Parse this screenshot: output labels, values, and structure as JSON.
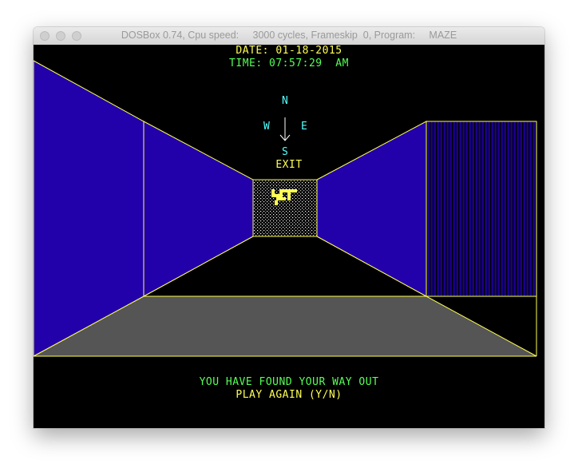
{
  "window": {
    "title": "DOSBox 0.74, Cpu speed:     3000 cycles, Frameskip  0, Program:     MAZE"
  },
  "hud": {
    "date_text": "DATE: 01-18-2015",
    "time_text": "TIME: 07:57:29  AM"
  },
  "compass": {
    "north": "N",
    "south": "S",
    "west": "W",
    "east": "E"
  },
  "exit_label": "EXIT",
  "messages": {
    "found": "YOU HAVE FOUND YOUR WAY OUT",
    "prompt": "PLAY AGAIN (Y/N)"
  },
  "colors": {
    "wall": "#2200aa",
    "edge": "#ffff55",
    "floor": "#555555",
    "background": "#000000",
    "text_yellow": "#ffff55",
    "text_green": "#55ff55",
    "text_cyan": "#55ffff"
  }
}
